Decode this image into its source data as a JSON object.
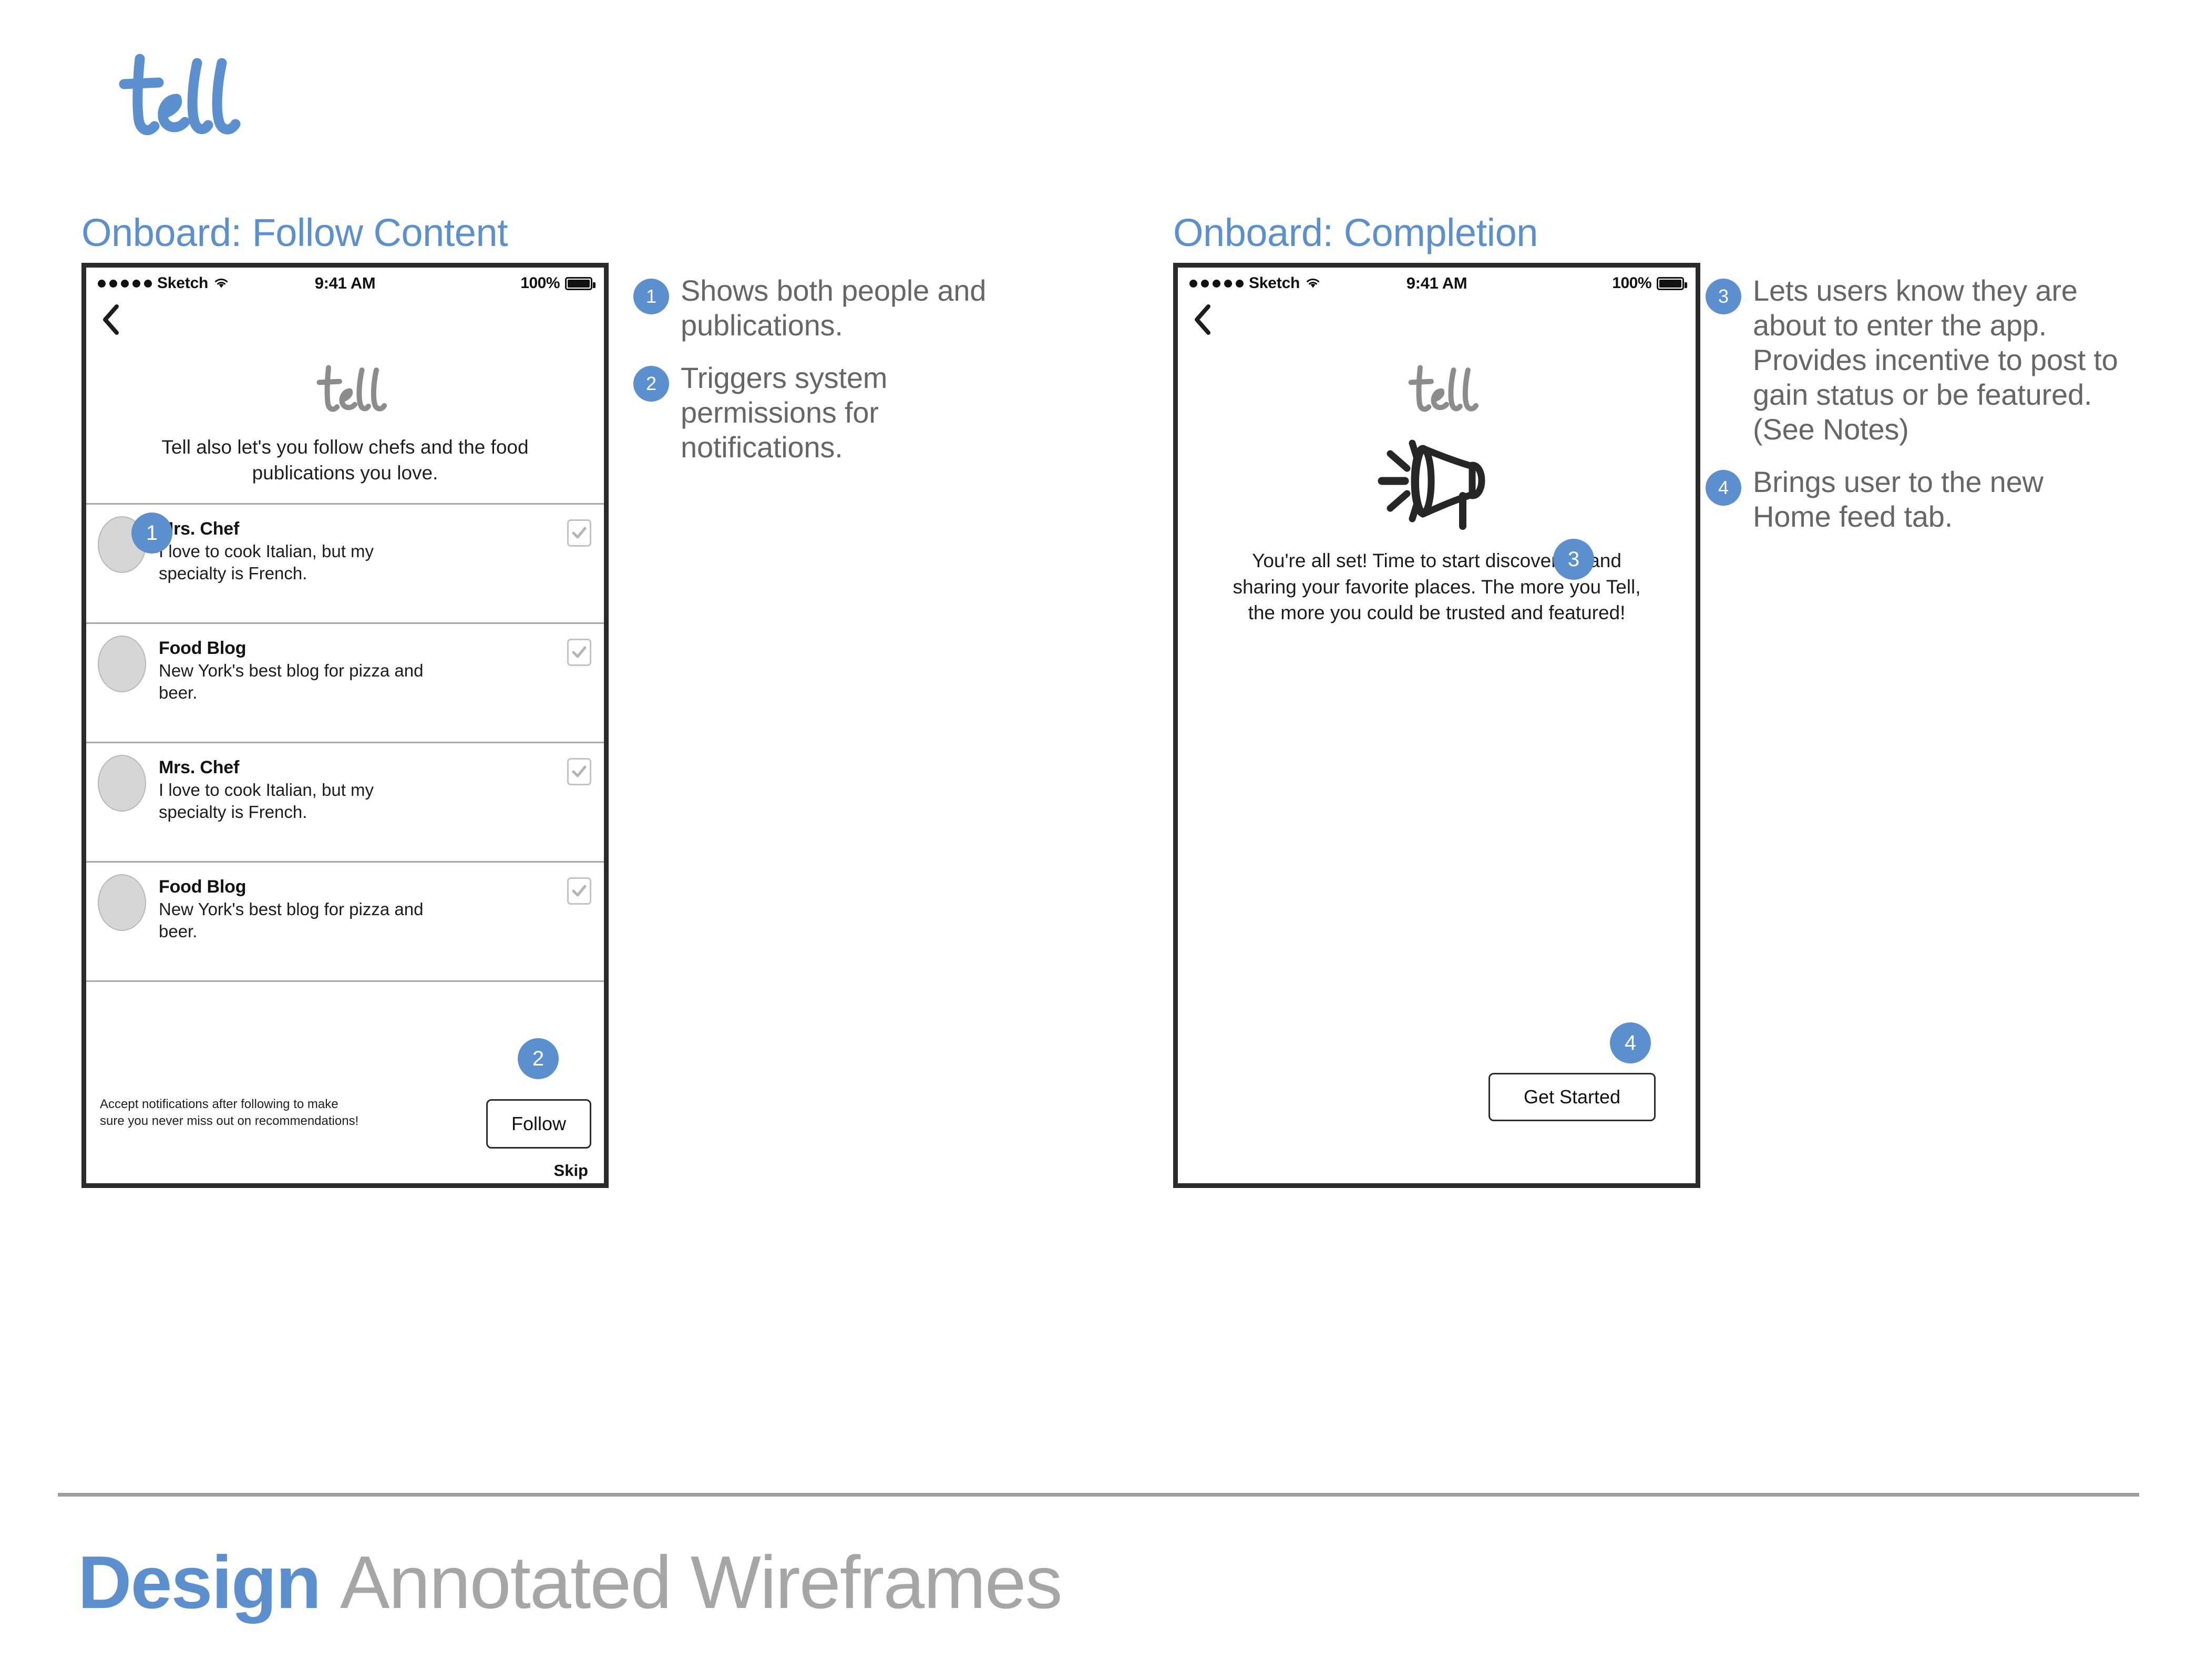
{
  "brand": {
    "logo_text": "tell"
  },
  "screens": [
    {
      "title": "Onboard: Follow Content",
      "status_bar": {
        "carrier": "Sketch",
        "time": "9:41 AM",
        "battery_percent": "100%",
        "signal_dots": 5,
        "wifi_icon": "wifi-icon",
        "battery_icon": "battery-icon"
      },
      "back_icon": "chevron-left-icon",
      "app_logo": "tell",
      "intro_copy": "Tell also let's you follow chefs and the food publications you love.",
      "list": [
        {
          "name": "Mrs. Chef",
          "desc": "I love to cook Italian, but my specialty is French.",
          "checked": true
        },
        {
          "name": "Food Blog",
          "desc": "New York's best blog for pizza and beer.",
          "checked": true
        },
        {
          "name": "Mrs. Chef",
          "desc": "I love to cook Italian, but my specialty is French.",
          "checked": true
        },
        {
          "name": "Food Blog",
          "desc": "New York's best blog for pizza and beer.",
          "checked": true
        }
      ],
      "footer_note": "Accept notifications after following to make sure you never miss out on recommendations!",
      "primary_button": "Follow",
      "skip_link": "Skip",
      "inline_badges": [
        "1",
        "2"
      ]
    },
    {
      "title": "Onboard: Completion",
      "status_bar": {
        "carrier": "Sketch",
        "time": "9:41 AM",
        "battery_percent": "100%",
        "signal_dots": 5,
        "wifi_icon": "wifi-icon",
        "battery_icon": "battery-icon"
      },
      "back_icon": "chevron-left-icon",
      "app_logo": "tell",
      "hero_icon": "megaphone-icon",
      "body_copy": "You're all set! Time to start discovering and sharing your favorite places. The more you Tell, the more you could be trusted and featured!",
      "primary_button": "Get Started",
      "inline_badges": [
        "3",
        "4"
      ]
    }
  ],
  "annotations_middle": [
    {
      "number": "1",
      "text": "Shows both people and publications."
    },
    {
      "number": "2",
      "text": "Triggers system permissions for notifications."
    }
  ],
  "annotations_right": [
    {
      "number": "3",
      "text": "Lets users know they are about to enter the app. Provides incentive to post to gain status or be featured. (See Notes)"
    },
    {
      "number": "4",
      "text": "Brings user to the new Home feed tab."
    }
  ],
  "footer": {
    "strong": "Design",
    "light": "Annotated Wireframes"
  },
  "colors": {
    "accent": "#5b8fce",
    "text_gray": "#666666",
    "footer_light": "#a6a6a6",
    "rule": "#9d9d9d",
    "frame": "#2b2b2b"
  }
}
